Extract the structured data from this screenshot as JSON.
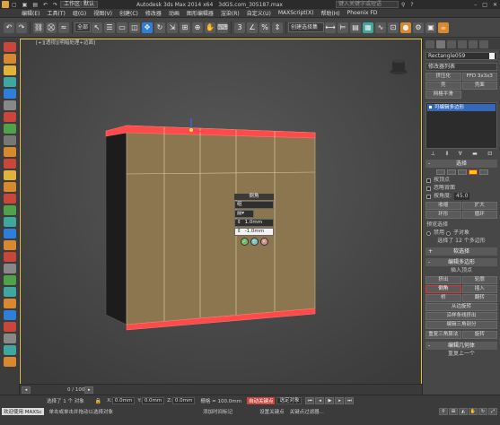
{
  "titlebar": {
    "workspace_label": "工作区: 默认",
    "app_title": "Autodesk 3ds Max  2014 x64",
    "file_name": "3dGS.com_305187.max",
    "search_placeholder": "键入关键字或短语"
  },
  "menubar": {
    "items": [
      "编辑(E)",
      "工具(T)",
      "组(G)",
      "视图(V)",
      "创建(C)",
      "修改器",
      "动画",
      "图形编辑器",
      "渲染(R)",
      "自定义(U)",
      "MAXScript(X)",
      "帮助(H)",
      "Phoenix FD"
    ]
  },
  "toolbar": {
    "selection_filter": "全部",
    "selection_set": "创建选择集"
  },
  "viewport": {
    "label": "[+][透视][明暗处理+边面]",
    "caddy": {
      "title": "倒角",
      "group": "组",
      "height_value": "1.0mm",
      "outline_value": "-1.0mm"
    }
  },
  "cmdpanel": {
    "object_name": "Rectangle059",
    "modifier_list": "修改器列表",
    "buttons": [
      "挤压化",
      "FFD 3x3x3",
      "壳",
      "壳面",
      "网格平滑"
    ],
    "stack_item": "可编辑多边形",
    "selection_rollout": "选择",
    "by_vertex": "按顶点",
    "ignore_backface": "忽略背面",
    "by_angle": "按角度:",
    "angle_value": "45.0",
    "shrink": "收缩",
    "grow": "扩大",
    "ring": "环形",
    "loop": "循环",
    "preview_selection": "预览选择",
    "disabled": "禁用",
    "subobject": "子对象",
    "multi": "多个",
    "selected_info": "选择了 12 个多边形",
    "soft_selection": "软选择",
    "edit_polygons": "编辑多边形",
    "insert_vertex": "插入顶点",
    "extrude": "挤出",
    "outline": "轮廓",
    "bevel": "倒角",
    "inset": "插入",
    "bridge": "桥",
    "flip": "翻转",
    "hinge_from_edge": "从边旋转",
    "extrude_along_spline": "沿样条线挤出",
    "edit_triangulation": "编辑三角剖分",
    "retriangulate": "重复三角算法",
    "turn": "旋转",
    "edit_geometry": "编辑几何体",
    "repeat_last": "重复上一个"
  },
  "timeline": {
    "frame": "0 / 100"
  },
  "statusbar": {
    "max_label": "欢迎使用 MAXSc",
    "selected_count": "选择了 1 个 对象",
    "hint": "单击或单击并拖动以选择对象",
    "x_label": "X:",
    "x_value": "0.0mm",
    "y_label": "Y:",
    "y_value": "0.0mm",
    "z_label": "Z:",
    "z_value": "0.0mm",
    "grid": "栅格 = 100.0mm",
    "autokey": "自动关键点",
    "selected_obj": "选定对象",
    "add_time_tag": "添加时间标记",
    "set_key": "设置关键点",
    "key_filters": "关键点过滤器..."
  },
  "colors": {
    "viewport_border": "#e6c347",
    "selected_face": "#ff4a4a",
    "object_wood": "#8c7650",
    "accent_blue": "#2f7fd8"
  }
}
